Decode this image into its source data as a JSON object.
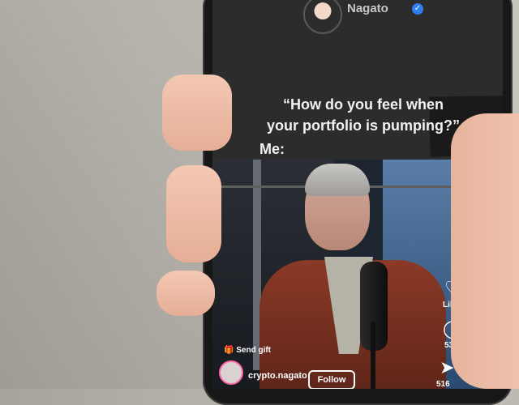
{
  "header": {
    "username": "Nagato"
  },
  "caption": {
    "line1": "“How do you feel when",
    "line2": "your portfolio is pumping?”",
    "me": "Me:"
  },
  "video": {
    "side_counts": {
      "likes": "Likes",
      "comments": "53",
      "shares": "516"
    },
    "send_gift": "Send gift",
    "account": "crypto.nagato",
    "follow": "Follow"
  },
  "icons": {
    "verified": "verified-icon",
    "heart": "heart-icon",
    "comment": "comment-icon",
    "share": "share-icon",
    "gift": "gift-icon"
  }
}
